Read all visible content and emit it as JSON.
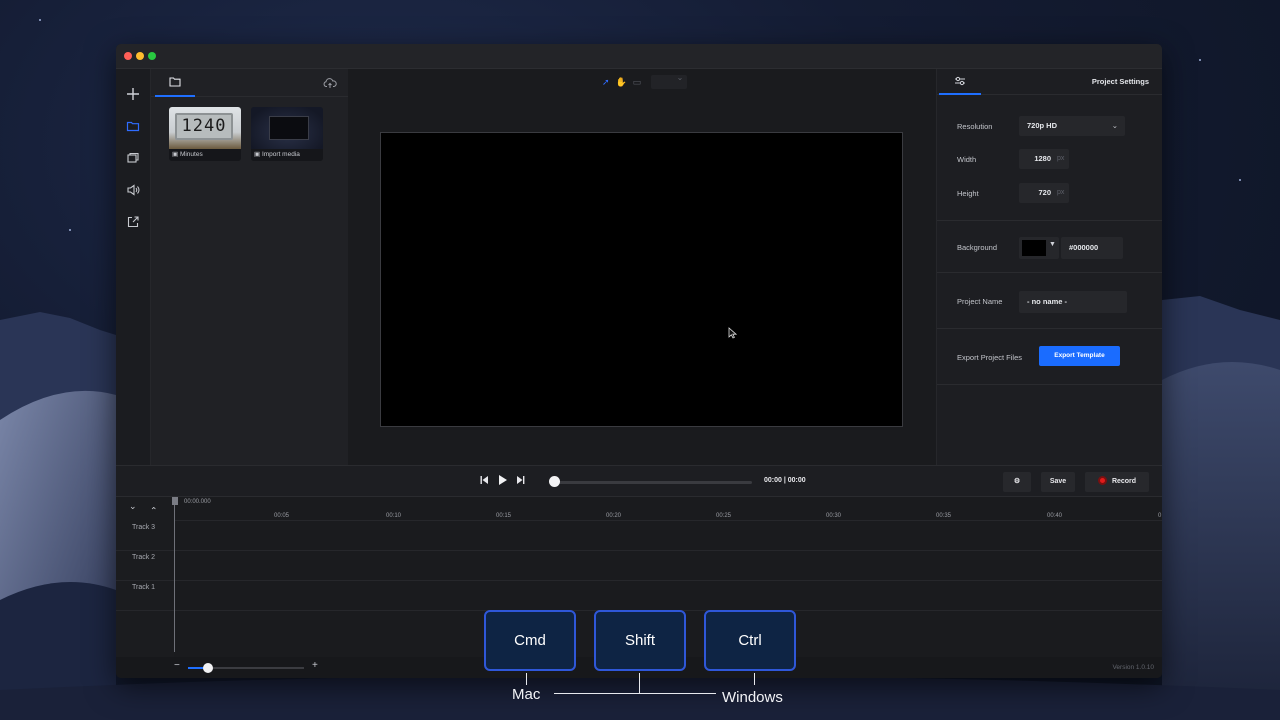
{
  "app": {
    "window_buttons": [
      "close",
      "minimize",
      "maximize"
    ]
  },
  "left_toolbar": [
    {
      "name": "add-icon"
    },
    {
      "name": "folder-icon",
      "active": true
    },
    {
      "name": "layers-icon"
    },
    {
      "name": "audio-icon"
    },
    {
      "name": "export-icon"
    }
  ],
  "media": {
    "items": [
      {
        "label": "Minutes",
        "display": "1240"
      },
      {
        "label": "Import media"
      }
    ]
  },
  "canvas": {
    "tools": [
      "select-tool-icon",
      "hand-tool-icon",
      "frame-tool-icon"
    ],
    "background": "#000000"
  },
  "settings": {
    "title": "Project Settings",
    "resolution_label": "Resolution",
    "resolution_value": "720p HD",
    "width_label": "Width",
    "width_value": "1280",
    "height_label": "Height",
    "height_value": "720",
    "unit": "px",
    "background_label": "Background",
    "background_value": "#000000",
    "project_name_label": "Project Name",
    "project_name_value": "- no name -",
    "export_label": "Export Project Files",
    "export_button": "Export Template"
  },
  "transport": {
    "time": "00:00 | 00:00",
    "save_label": "Save",
    "record_label": "Record"
  },
  "timeline": {
    "start_time": "00:00.000",
    "ticks": [
      "00:05",
      "00:10",
      "00:15",
      "00:20",
      "00:25",
      "00:30",
      "00:35",
      "00:40",
      "0"
    ],
    "tracks": [
      "Track 3",
      "Track 2",
      "Track 1"
    ]
  },
  "footer": {
    "version": "Version 1.0.10"
  },
  "overlay": {
    "keys": [
      "Cmd",
      "Shift",
      "Ctrl"
    ],
    "mac_label": "Mac",
    "windows_label": "Windows"
  },
  "colors": {
    "accent": "#1f6fff",
    "record": "#e21b1b",
    "key_border": "#2f57d9"
  }
}
